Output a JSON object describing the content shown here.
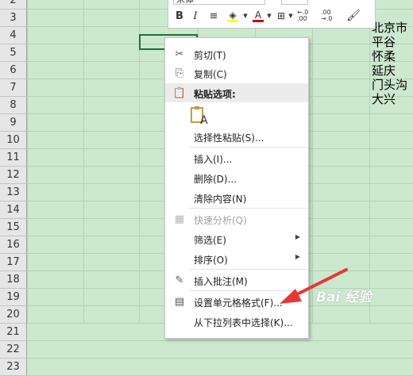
{
  "spreadsheet": {
    "row_numbers": [
      "2",
      "3",
      "4",
      "5",
      "6",
      "7",
      "8",
      "9",
      "10",
      "11",
      "12",
      "13",
      "14",
      "15",
      "16",
      "17",
      "18",
      "19",
      "20",
      "21",
      "22",
      "23"
    ],
    "cell_values": [
      "北京市",
      "平谷",
      "怀柔",
      "延庆",
      "门头沟",
      "大兴"
    ]
  },
  "mini_toolbar": {
    "font_name": "宋体",
    "bold": "B",
    "italic": "I",
    "align": "≡",
    "font_color_letter": "A",
    "percent": "%",
    "comma": ",",
    "increase_decimal": "←.0 .00",
    "decrease_decimal": ".00 →.0"
  },
  "context_menu": {
    "cut": "剪切(T)",
    "copy": "复制(C)",
    "paste_options": "粘贴选项:",
    "paste_special": "选择性粘贴(S)...",
    "insert": "插入(I)...",
    "delete": "删除(D)...",
    "clear_contents": "清除内容(N)",
    "quick_analysis": "快速分析(Q)",
    "filter": "筛选(E)",
    "sort": "排序(O)",
    "insert_comment": "插入批注(M)",
    "format_cells": "设置单元格格式(F)...",
    "pick_from_list": "从下拉列表中选择(K)..."
  },
  "watermark": "Bai 经验",
  "colors": {
    "sheet_bg": "#cce8cf",
    "selection_border": "#1f6e3a",
    "arrow": "#e53935",
    "font_color_bar": "#d00000",
    "fill_color_bar": "#ffff00"
  }
}
